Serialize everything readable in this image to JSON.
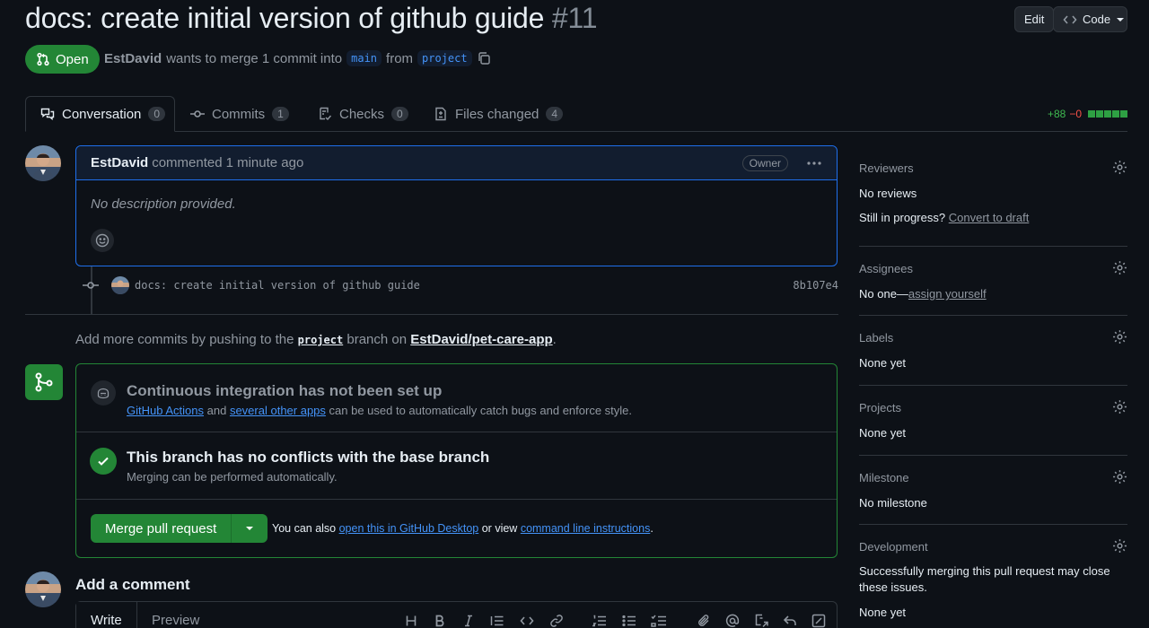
{
  "header": {
    "title": "docs: create initial version of github guide",
    "number": "#11",
    "edit_label": "Edit",
    "code_label": "Code"
  },
  "state": {
    "label": "Open",
    "color": "#238636"
  },
  "meta": {
    "author": "EstDavid",
    "text_merge": "wants to merge 1 commit into",
    "base_branch": "main",
    "text_from": "from",
    "head_branch": "project"
  },
  "tabs": [
    {
      "label": "Conversation",
      "count": "0",
      "icon": "comment-discussion-icon"
    },
    {
      "label": "Commits",
      "count": "1",
      "icon": "git-commit-icon"
    },
    {
      "label": "Checks",
      "count": "0",
      "icon": "checklist-icon"
    },
    {
      "label": "Files changed",
      "count": "4",
      "icon": "file-diff-icon"
    }
  ],
  "diffstat": {
    "additions": "+88",
    "deletions": "−0"
  },
  "comment": {
    "author": "EstDavid",
    "action": "commented",
    "time": "1 minute ago",
    "badge": "Owner",
    "body": "No description provided."
  },
  "commit": {
    "message": "docs: create initial version of github guide",
    "sha": "8b107e4"
  },
  "push_note": {
    "prefix": "Add more commits by pushing to the",
    "branch": "project",
    "mid": "branch on",
    "repo": "EstDavid/pet-care-app",
    "suffix": "."
  },
  "merge": {
    "ci_title": "Continuous integration has not been set up",
    "ci_link1": "GitHub Actions",
    "ci_and": "and",
    "ci_link2": "several other apps",
    "ci_rest": "can be used to automatically catch bugs and enforce style.",
    "conflict_title": "This branch has no conflicts with the base branch",
    "conflict_sub": "Merging can be performed automatically.",
    "button_label": "Merge pull request",
    "also_text": "You can also",
    "desktop_link": "open this in GitHub Desktop",
    "or_view": "or view",
    "cli_link": "command line instructions",
    "end": "."
  },
  "add_comment": {
    "title": "Add a comment",
    "write_tab": "Write",
    "preview_tab": "Preview"
  },
  "sidebar": {
    "reviewers": {
      "title": "Reviewers",
      "value": "No reviews",
      "progress_text": "Still in progress?",
      "draft_link": "Convert to draft"
    },
    "assignees": {
      "title": "Assignees",
      "value": "No one—",
      "link": "assign yourself"
    },
    "labels": {
      "title": "Labels",
      "value": "None yet"
    },
    "projects": {
      "title": "Projects",
      "value": "None yet"
    },
    "milestone": {
      "title": "Milestone",
      "value": "No milestone"
    },
    "development": {
      "title": "Development",
      "value": "Successfully merging this pull request may close these issues.",
      "value2": "None yet"
    }
  },
  "colors": {
    "accent": "#4493f8",
    "success": "#238636",
    "background": "#0d1117",
    "border": "#30363d"
  }
}
